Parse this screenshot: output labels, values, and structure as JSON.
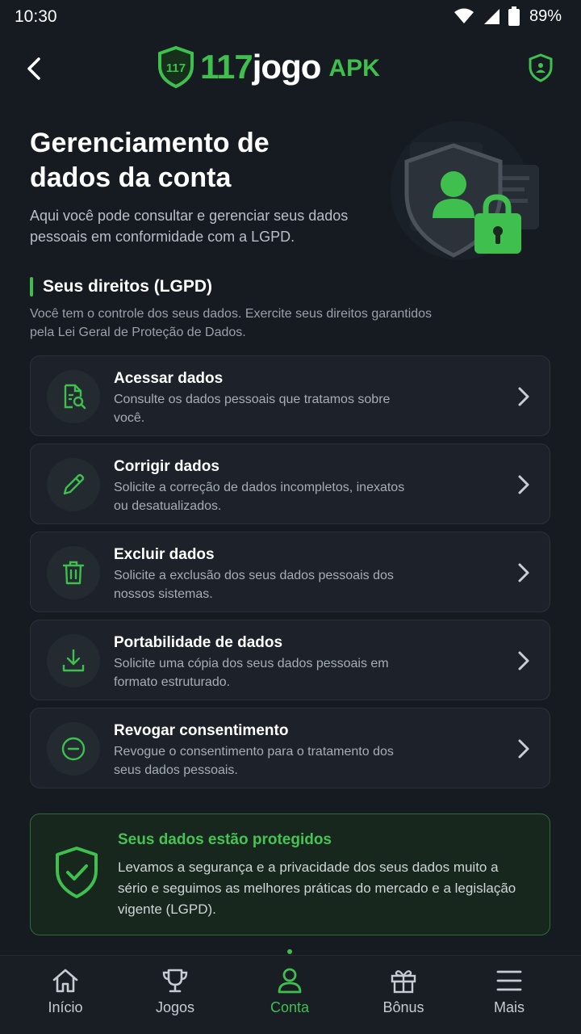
{
  "status_bar": {
    "time": "10:30",
    "battery": "89%"
  },
  "header": {
    "logo_num": "117",
    "logo_word": "jogo",
    "logo_suffix": "APK",
    "badge_num": "117"
  },
  "hero": {
    "title": "Gerenciamento de dados da conta",
    "description": "Aqui você pode consultar e gerenciar seus dados pessoais em conformidade com a LGPD."
  },
  "rights": {
    "title": "Seus direitos (LGPD)",
    "description": "Você tem o controle dos seus dados. Exercite seus direitos garantidos pela Lei Geral de Proteção de Dados.",
    "items": [
      {
        "title": "Acessar dados",
        "description": "Consulte os dados pessoais que tratamos sobre você.",
        "icon": "document-search-icon"
      },
      {
        "title": "Corrigir dados",
        "description": "Solicite a correção de dados incompletos, inexatos ou desatualizados.",
        "icon": "pencil-icon"
      },
      {
        "title": "Excluir dados",
        "description": "Solicite a exclusão dos seus dados pessoais dos nossos sistemas.",
        "icon": "trash-icon"
      },
      {
        "title": "Portabilidade de dados",
        "description": "Solicite uma cópia dos seus dados pessoais em formato estruturado.",
        "icon": "download-icon"
      },
      {
        "title": "Revogar consentimento",
        "description": "Revogue o consentimento para o tratamento dos seus dados pessoais.",
        "icon": "minus-circle-icon"
      }
    ]
  },
  "protection": {
    "title": "Seus dados estão protegidos",
    "description": "Levamos a segurança e a privacidade dos seus dados muito a sério e seguimos as melhores práticas do mercado e a legislação vigente (LGPD)."
  },
  "nav": {
    "items": [
      {
        "label": "Início",
        "icon": "home-icon"
      },
      {
        "label": "Jogos",
        "icon": "trophy-icon"
      },
      {
        "label": "Conta",
        "icon": "user-icon",
        "active": true
      },
      {
        "label": "Bônus",
        "icon": "gift-icon"
      },
      {
        "label": "Mais",
        "icon": "menu-icon"
      }
    ]
  },
  "colors": {
    "accent": "#3fbf4e",
    "background": "#161a21",
    "card": "#1d222a"
  }
}
